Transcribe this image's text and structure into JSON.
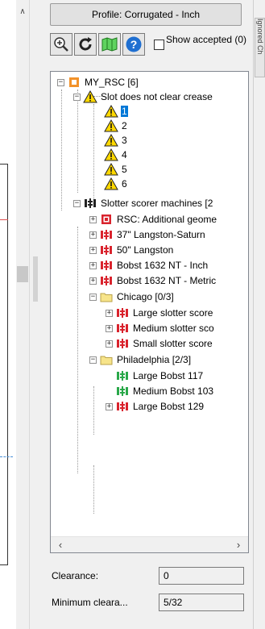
{
  "profile_button": "Profile: Corrugated - Inch",
  "toolbar": {
    "icons": [
      "zoom-in-icon",
      "refresh-icon",
      "map-icon",
      "help-icon"
    ],
    "show_accepted_label": "Show accepted (0)",
    "show_accepted_checked": false
  },
  "tree": {
    "root": "MY_RSC [6]",
    "slot_group": "Slot does not clear crease",
    "slot_items": [
      "1",
      "2",
      "3",
      "4",
      "5",
      "6"
    ],
    "selected_item": "1",
    "machines_group": "Slotter scorer machines [2",
    "machines": [
      "RSC: Additional geome",
      "37\" Langston-Saturn",
      "50\" Langston",
      "Bobst 1632 NT - Inch",
      "Bobst 1632 NT - Metric"
    ],
    "chicago": {
      "label": "Chicago [0/3]",
      "items": [
        "Large slotter score",
        "Medium slotter sco",
        "Small slotter score"
      ]
    },
    "philadelphia": {
      "label": "Philadelphia [2/3]",
      "items": [
        "Large Bobst 117",
        "Medium Bobst 103",
        "Large Bobst 129"
      ]
    }
  },
  "fields": {
    "clearance_label": "Clearance:",
    "clearance_value": "0",
    "min_clearance_label": "Minimum cleara...",
    "min_clearance_value": "5/32"
  },
  "side_tab_label": "Ignored Ch",
  "colors": {
    "selection": "#0078d7",
    "warning_yellow": "#ffd800",
    "machine_red": "#d9232d",
    "machine_green": "#2aa84a",
    "folder_yellow": "#f7e48a"
  }
}
